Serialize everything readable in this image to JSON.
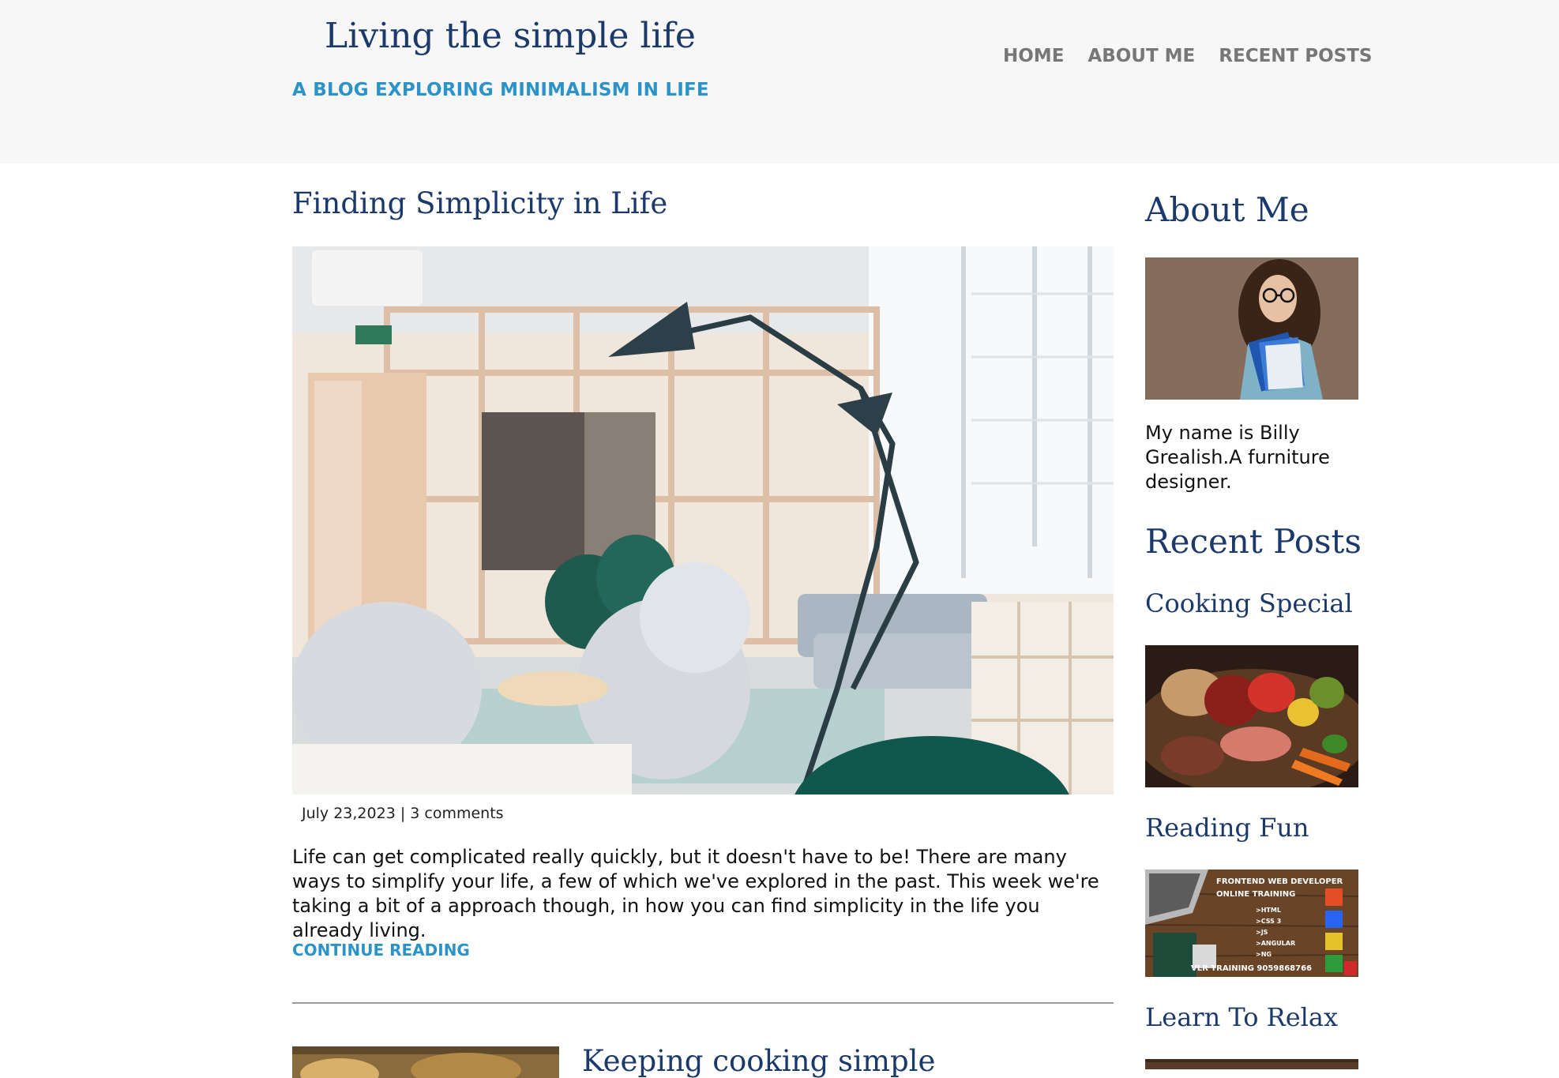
{
  "header": {
    "site_title": "Living the simple life",
    "tagline": "A BLOG EXPLORING MINIMALISM IN LIFE",
    "nav": [
      "HOME",
      "ABOUT ME",
      "RECENT POSTS"
    ]
  },
  "main_post": {
    "title": "Finding Simplicity in Life",
    "meta": "July 23,2023 | 3 comments",
    "excerpt": "Life can get complicated really quickly, but it doesn't have to be! There are many ways to simplify your life, a few of which we've explored in the past. This week we're taking a bit of a approach though, in how you can find simplicity in the life you already living.",
    "continue_label": "CONTINUE READING",
    "image": "minimalist-interior-photo"
  },
  "next_post": {
    "title": "Keeping cooking simple"
  },
  "sidebar": {
    "about_heading": "About Me",
    "about_text": "My name is Billy Grealish.A furniture designer.",
    "recent_heading": "Recent Posts",
    "recent": [
      {
        "title": "Cooking Special",
        "image": "food-ingredients-photo"
      },
      {
        "title": "Reading Fun",
        "image": "training-banner",
        "banner_lines": [
          "FRONTEND WEB DEVELOPER",
          "ONLINE TRAINING",
          ">HTML",
          ">CSS 3",
          ">JS",
          ">ANGULAR",
          ">NG",
          "VLR TRAINING 9059868766"
        ]
      },
      {
        "title": "Learn To Relax",
        "image": "relax-photo"
      }
    ]
  },
  "colors": {
    "heading": "#1b3a6b",
    "accent": "#2c93c9",
    "nav": "#777777",
    "header_bg": "#f7f7f7"
  }
}
